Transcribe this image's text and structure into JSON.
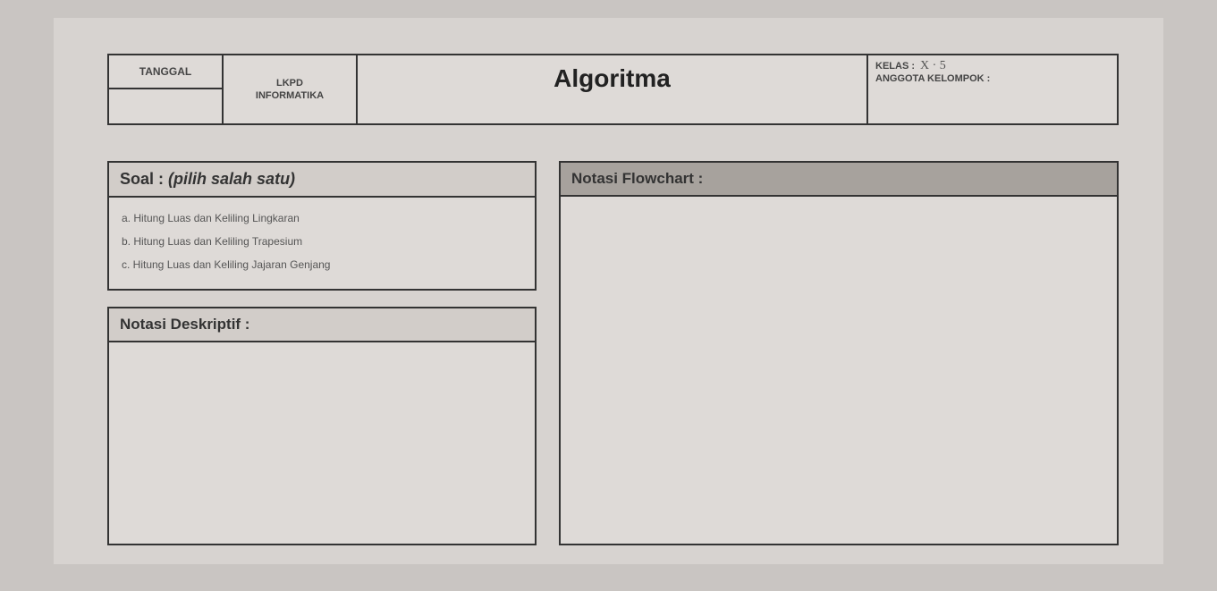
{
  "header": {
    "tanggal_label": "TANGGAL",
    "lkpd_line1": "LKPD",
    "lkpd_line2": "INFORMATIKA",
    "title": "Algoritma",
    "kelas_label": "KELAS :",
    "kelas_value": "X · 5",
    "anggota_label": "ANGGOTA KELOMPOK :"
  },
  "soal": {
    "label": "Soal :",
    "hint": "(pilih salah satu)",
    "options": {
      "a": "a. Hitung Luas dan Keliling Lingkaran",
      "b": "b. Hitung Luas dan Keliling Trapesium",
      "c": "c. Hitung Luas dan Keliling Jajaran Genjang"
    }
  },
  "deskriptif": {
    "heading": "Notasi Deskriptif :"
  },
  "flowchart": {
    "heading": "Notasi Flowchart :"
  }
}
